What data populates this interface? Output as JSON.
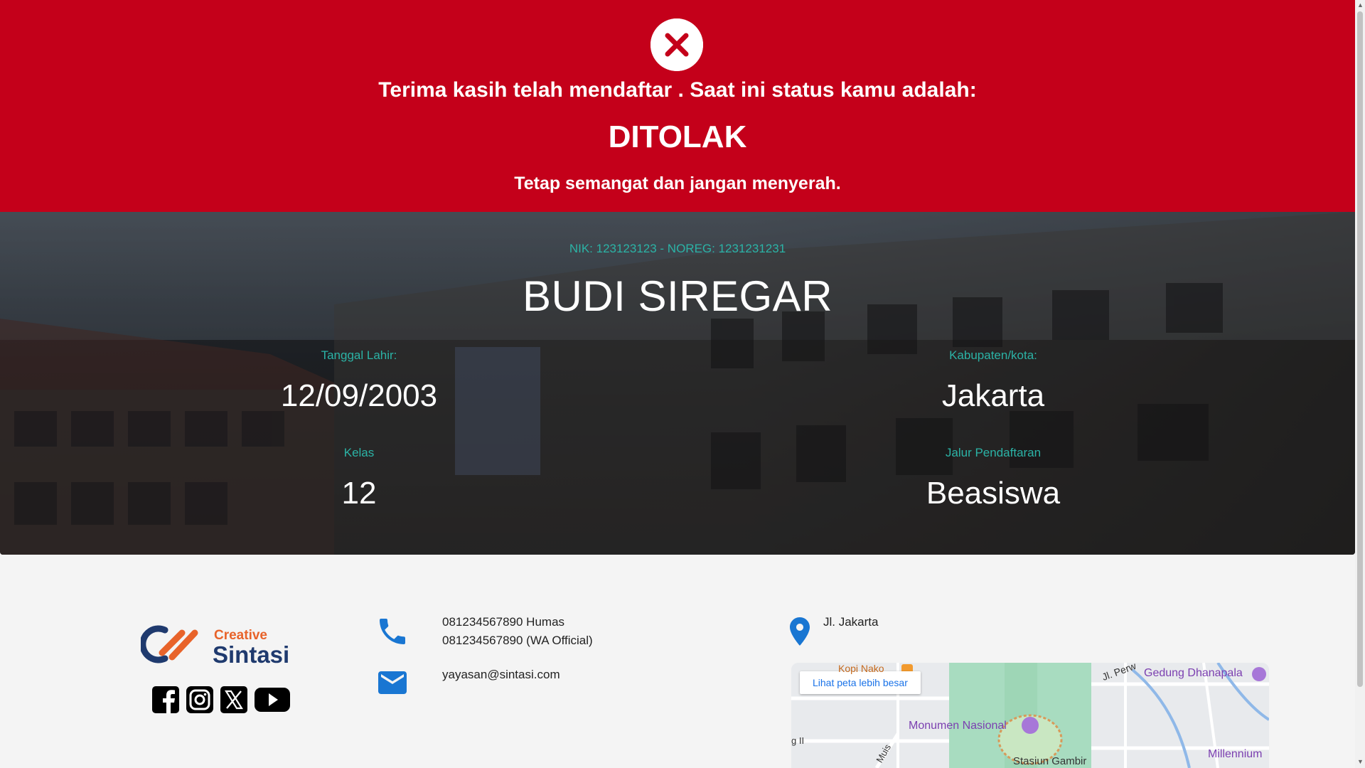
{
  "status": {
    "message": "Terima kasih telah mendaftar . Saat ini status kamu adalah:",
    "value": "DITOLAK",
    "encouragement": "Tetap semangat dan jangan menyerah.",
    "icon": "close-circle-icon",
    "color": "#c4001a"
  },
  "applicant": {
    "id_line": "NIK: 123123123 - NOREG: 1231231231",
    "name": "BUDI SIREGAR",
    "birth_date_label": "Tanggal Lahir:",
    "birth_date": "12/09/2003",
    "city_label": "Kabupaten/kota:",
    "city": "Jakarta",
    "class_label": "Kelas",
    "class": "12",
    "path_label": "Jalur Pendaftaran",
    "path": "Beasiswa"
  },
  "footer": {
    "logo_top": "Creative",
    "logo_bottom": "Sintasi",
    "phones": [
      "081234567890 Humas",
      "081234567890 (WA Official)"
    ],
    "email": "yayasan@sintasi.com",
    "address": "Jl. Jakarta",
    "social": [
      "facebook-icon",
      "instagram-icon",
      "x-icon",
      "youtube-icon"
    ],
    "map": {
      "button": "Lihat peta lebih besar",
      "labels": {
        "monas": "Monumen Nasional",
        "gedung": "Gedung Dhanapala",
        "stasiun": "Stasiun Gambir",
        "millennium": "Millennium",
        "kopi": "Kopi Nako",
        "perw": "Jl. Perw",
        "muis": "Muis",
        "ii": "g II"
      }
    }
  }
}
